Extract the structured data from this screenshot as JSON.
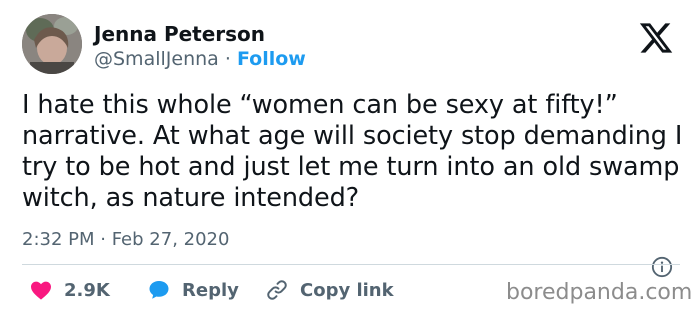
{
  "author": {
    "display_name": "Jenna Peterson",
    "handle": "@SmallJenna",
    "separator": "·",
    "follow_label": "Follow"
  },
  "tweet": {
    "text": "I hate this whole “women can be sexy at fifty!” narrative. At what age will society stop demanding I try to be hot and just let me turn into an old swamp witch, as nature intended?",
    "timestamp": "2:32 PM · Feb 27, 2020"
  },
  "actions": {
    "like_count": "2.9K",
    "reply_label": "Reply",
    "copy_link_label": "Copy link"
  },
  "icons": {
    "logo": "x-logo-icon",
    "info": "info-icon",
    "like": "heart-icon",
    "reply": "speech-bubble-icon",
    "copy": "link-icon"
  },
  "colors": {
    "accent": "#1d9bf0",
    "like": "#f91880",
    "text": "#0f1419",
    "muted": "#536471"
  },
  "watermark": "boredpanda.com"
}
